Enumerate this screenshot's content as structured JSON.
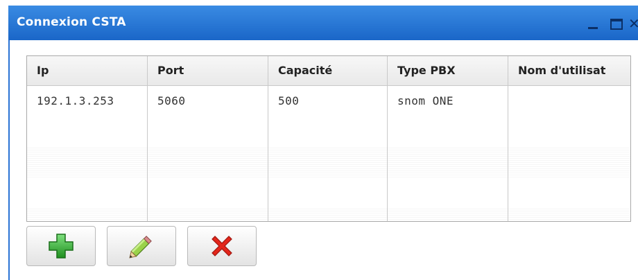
{
  "window": {
    "title": "Connexion CSTA",
    "controls": {
      "minimize": "minimize-icon",
      "maximize": "maximize-icon",
      "close": "close-icon"
    },
    "close_glyph": "✕"
  },
  "grid": {
    "columns": [
      "Ip",
      "Port",
      "Capacité",
      "Type PBX",
      "Nom d'utilisat"
    ],
    "rows": [
      [
        "192.1.3.253",
        "5060",
        "500",
        "snom ONE",
        ""
      ]
    ]
  },
  "toolbar": {
    "buttons": [
      {
        "name": "add-button",
        "icon": "plus-icon"
      },
      {
        "name": "edit-button",
        "icon": "pencil-icon"
      },
      {
        "name": "delete-button",
        "icon": "x-icon"
      }
    ]
  },
  "colors": {
    "titlebar": "#1a66c8",
    "add": "#2fa52f",
    "delete": "#e3261b"
  }
}
